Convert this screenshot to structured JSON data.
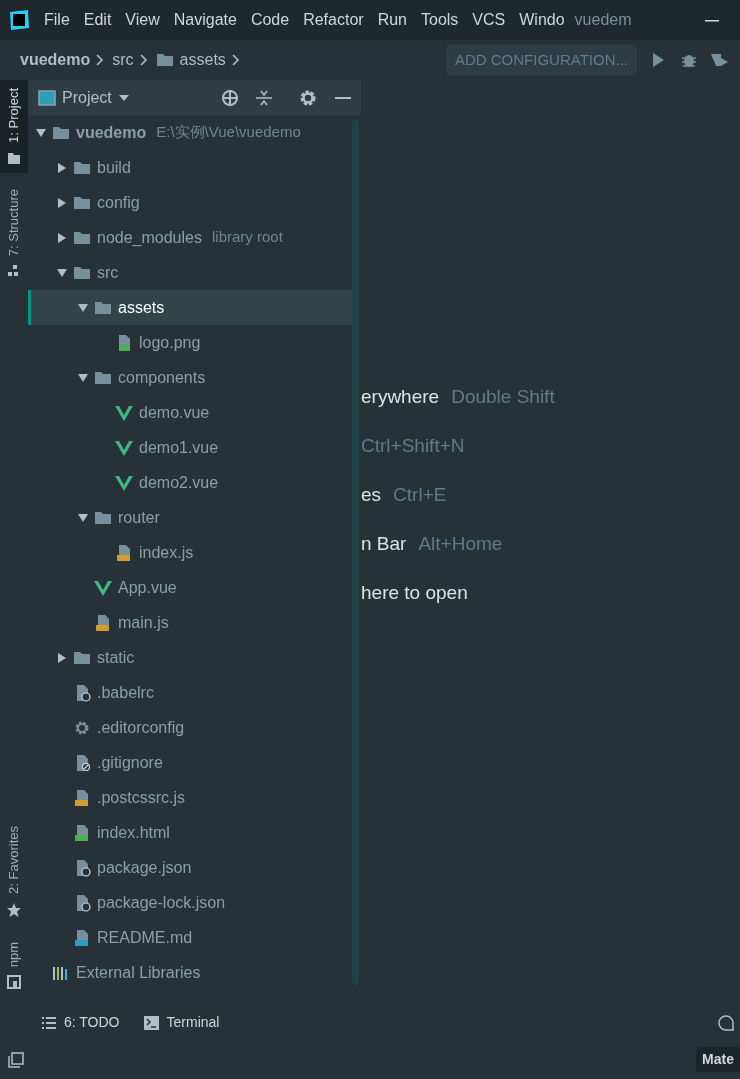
{
  "menu": [
    {
      "label": "File"
    },
    {
      "label": "Edit"
    },
    {
      "label": "View"
    },
    {
      "label": "Navigate"
    },
    {
      "label": "Code"
    },
    {
      "label": "Refactor"
    },
    {
      "label": "Run"
    },
    {
      "label": "Tools"
    },
    {
      "label": "VCS"
    },
    {
      "label": "Windo"
    }
  ],
  "window": {
    "title": "vuedem"
  },
  "breadcrumb": [
    {
      "label": "vuedemo",
      "kind": "project"
    },
    {
      "label": "src",
      "kind": "plain"
    },
    {
      "label": "assets",
      "kind": "folder"
    }
  ],
  "run_config": {
    "label": "ADD CONFIGURATION..."
  },
  "left_tabs": [
    {
      "label": "1: Project",
      "kind": "folder",
      "selected": true
    },
    {
      "label": "7: Structure",
      "kind": "structure",
      "selected": false
    }
  ],
  "left_tabs_bottom": [
    {
      "label": "2: Favorites",
      "kind": "star",
      "selected": false
    },
    {
      "label": "npm",
      "kind": "npm",
      "selected": false
    }
  ],
  "project_panel": {
    "title": "Project"
  },
  "tree": [
    {
      "name": "vuedemo",
      "kind": "folder",
      "bold": true,
      "hint": "E:\\实例\\Vue\\vuedemo",
      "expanded": true,
      "selected": false,
      "children": [
        {
          "name": "build",
          "kind": "folder",
          "expanded": false,
          "selected": false
        },
        {
          "name": "config",
          "kind": "folder",
          "expanded": false,
          "selected": false
        },
        {
          "name": "node_modules",
          "kind": "folder",
          "hint": "library root",
          "expanded": false,
          "selected": false
        },
        {
          "name": "src",
          "kind": "folder",
          "expanded": true,
          "selected": false,
          "children": [
            {
              "name": "assets",
              "kind": "folder",
              "expanded": true,
              "selected": true,
              "children": [
                {
                  "name": "logo.png",
                  "kind": "image",
                  "selected": false
                }
              ]
            },
            {
              "name": "components",
              "kind": "folder",
              "expanded": true,
              "selected": false,
              "children": [
                {
                  "name": "demo.vue",
                  "kind": "vue",
                  "selected": false
                },
                {
                  "name": "demo1.vue",
                  "kind": "vue",
                  "selected": false
                },
                {
                  "name": "demo2.vue",
                  "kind": "vue",
                  "selected": false
                }
              ]
            },
            {
              "name": "router",
              "kind": "folder",
              "expanded": true,
              "selected": false,
              "children": [
                {
                  "name": "index.js",
                  "kind": "js",
                  "selected": false
                }
              ]
            },
            {
              "name": "App.vue",
              "kind": "vue",
              "selected": false
            },
            {
              "name": "main.js",
              "kind": "js",
              "selected": false
            }
          ]
        },
        {
          "name": "static",
          "kind": "folder",
          "expanded": false,
          "selected": false
        },
        {
          "name": ".babelrc",
          "kind": "json",
          "selected": false
        },
        {
          "name": ".editorconfig",
          "kind": "gear",
          "selected": false
        },
        {
          "name": ".gitignore",
          "kind": "ignore",
          "selected": false
        },
        {
          "name": ".postcssrc.js",
          "kind": "js",
          "selected": false
        },
        {
          "name": "index.html",
          "kind": "html",
          "selected": false
        },
        {
          "name": "package.json",
          "kind": "json",
          "selected": false
        },
        {
          "name": "package-lock.json",
          "kind": "json",
          "selected": false
        },
        {
          "name": "README.md",
          "kind": "md",
          "selected": false
        }
      ]
    },
    {
      "name": "External Libraries",
      "kind": "libraries",
      "selected": false
    }
  ],
  "editor_hints": [
    {
      "text": "erywhere",
      "shortcut": "Double Shift"
    },
    {
      "shortcut": "Ctrl+Shift+N"
    },
    {
      "text": "es",
      "shortcut": "Ctrl+E"
    },
    {
      "text": "n Bar",
      "shortcut": "Alt+Home"
    },
    {
      "text": "here to open"
    }
  ],
  "bottom_tabs": [
    {
      "label": "6: TODO",
      "kind": "todo"
    },
    {
      "label": "Terminal",
      "kind": "terminal"
    }
  ],
  "status_bar": {
    "theme_badge": "Mate"
  }
}
